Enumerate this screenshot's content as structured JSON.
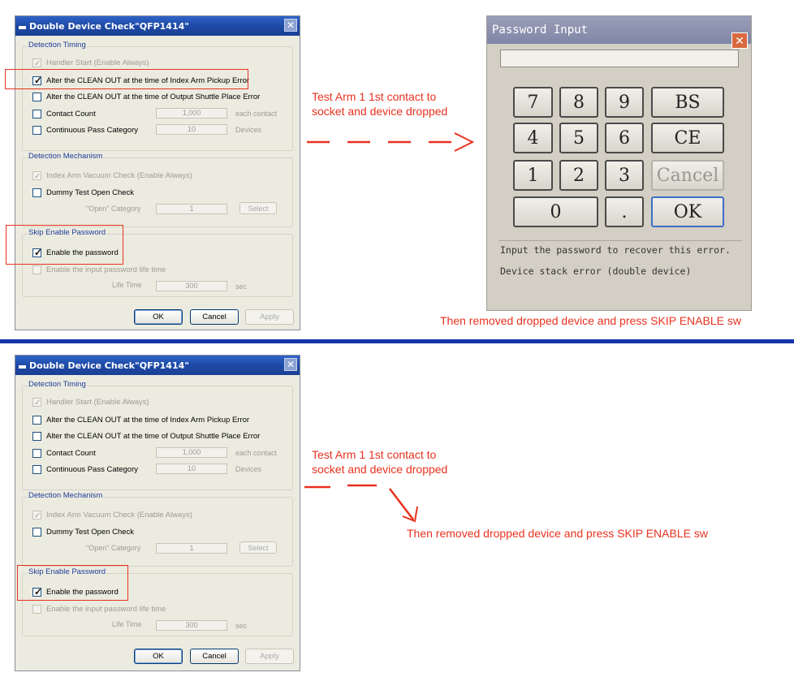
{
  "top_dialog": {
    "title": "Double Device Check\"QFP1414\"",
    "close_glyph": "✕",
    "timing_label": "Detection Timing",
    "handler_start": "Handler Start (Enable Always)",
    "alter_index": "Alter the CLEAN OUT at the time of Index Arm Pickup Error",
    "alter_output": "Alter the CLEAN OUT at the time of Output Shuttle Place Error",
    "contact_count": "Contact Count",
    "contact_value": "1,000",
    "contact_suffix": "each contact",
    "continuous_pass": "Continuous Pass Category",
    "continuous_value": "10",
    "continuous_suffix": "Devices",
    "mechanism_label": "Detection Mechanism",
    "index_vacuum": "Index Arm Vacuum Check (Enable Always)",
    "dummy_test": "Dummy Test Open Check",
    "open_category": "\"Open\" Category",
    "open_value": "1",
    "select_btn": "Select",
    "skip_label": "Skip Enable Password",
    "enable_password": "Enable the password",
    "enable_life": "Enable the input password life time",
    "life_time": "Life Time",
    "life_value": "300",
    "life_suffix": "sec",
    "ok": "OK",
    "cancel": "Cancel",
    "apply": "Apply"
  },
  "bottom_dialog": {
    "title": "Double Device Check\"QFP1414\"",
    "close_glyph": "✕",
    "timing_label": "Detection Timing",
    "handler_start": "Handler Start (Enable Always)",
    "alter_index": "Alter the CLEAN OUT at the time of Index Arm Pickup Error",
    "alter_output": "Alter the CLEAN OUT at the time of Output Shuttle Place Error",
    "contact_count": "Contact Count",
    "contact_value": "1,000",
    "contact_suffix": "each contact",
    "continuous_pass": "Continuous Pass Category",
    "continuous_value": "10",
    "continuous_suffix": "Devices",
    "mechanism_label": "Detection Mechanism",
    "index_vacuum": "Index Arm Vacuum Check (Enable Always)",
    "dummy_test": "Dummy Test Open Check",
    "open_category": "\"Open\" Category",
    "open_value": "1",
    "select_btn": "Select",
    "skip_label": "Skip Enable Password",
    "enable_password": "Enable the password",
    "enable_life": "Enable the input password life time",
    "life_time": "Life Time",
    "life_value": "300",
    "life_suffix": "sec",
    "ok": "OK",
    "cancel": "Cancel",
    "apply": "Apply"
  },
  "password_input": {
    "title": "Password Input",
    "close_glyph": "✕",
    "keys": [
      "7",
      "8",
      "9",
      "BS",
      "4",
      "5",
      "6",
      "CE",
      "1",
      "2",
      "3",
      "Cancel",
      "0",
      ".",
      "OK"
    ],
    "message1": "Input the password to recover this error.",
    "message2": "Device stack error (double device)"
  },
  "annotations": {
    "top_note_1": "Test Arm 1 1st contact to",
    "top_note_2": "socket and device dropped",
    "top_caption": "Then removed dropped device and press SKIP ENABLE sw",
    "bottom_note_1": "Test Arm 1 1st contact to",
    "bottom_note_2": "socket and device dropped",
    "bottom_caption": "Then removed dropped device and press SKIP ENABLE sw"
  },
  "colors": {
    "annotation_red": "#e8321f",
    "divider_blue": "#1435a8",
    "title_blue": "#1e4aa6"
  }
}
